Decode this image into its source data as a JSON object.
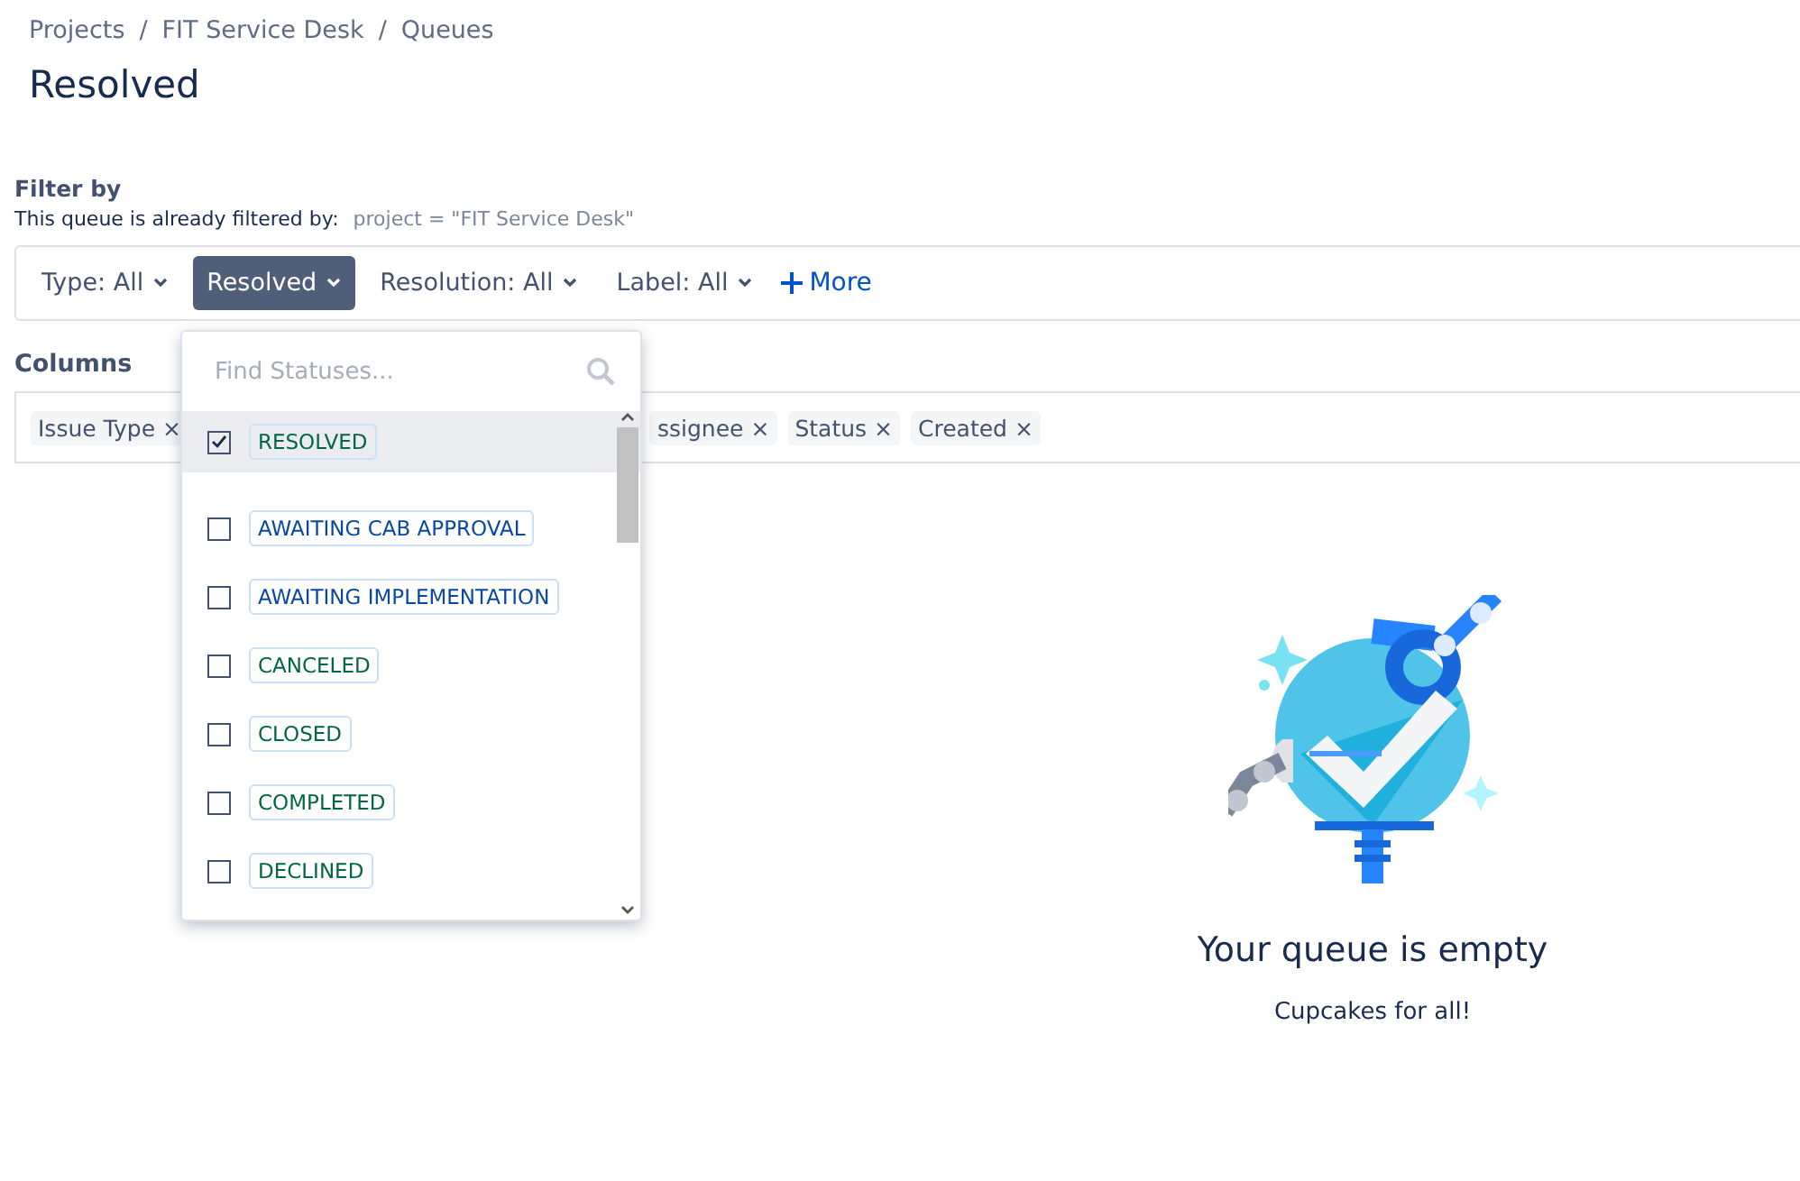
{
  "breadcrumbs": [
    {
      "label": "Projects"
    },
    {
      "separator": "/",
      "label": "FIT Service Desk"
    },
    {
      "separator": "/",
      "label": "Queues"
    }
  ],
  "title": "Resolved",
  "filter": {
    "heading": "Filter by",
    "note": "This queue is already filtered by:",
    "query": "project = \"FIT Service Desk\"",
    "buttons": [
      {
        "label": "Type: All",
        "selected": false
      },
      {
        "label": "Resolved",
        "selected": true
      },
      {
        "label": "Resolution: All",
        "selected": false
      },
      {
        "label": "Label: All",
        "selected": false
      }
    ],
    "more": "More"
  },
  "columns": {
    "heading": "Columns",
    "chips": [
      {
        "label": "Issue Type",
        "remove": "×"
      },
      {
        "label": "ssignee",
        "remove": "×"
      },
      {
        "label": "Status",
        "remove": "×"
      },
      {
        "label": "Created",
        "remove": "×"
      }
    ]
  },
  "dropdown": {
    "placeholder": "Find Statuses...",
    "items": [
      {
        "label": "RESOLVED",
        "checked": true,
        "selected": true,
        "color": "#006644"
      },
      {
        "label": "AWAITING CAB APPROVAL",
        "checked": false,
        "selected": false,
        "color": "#0747a6"
      },
      {
        "label": "AWAITING IMPLEMENTATION",
        "checked": false,
        "selected": false,
        "color": "#0747a6"
      },
      {
        "label": "CANCELED",
        "checked": false,
        "selected": false,
        "color": "#006644"
      },
      {
        "label": "CLOSED",
        "checked": false,
        "selected": false,
        "color": "#006644"
      },
      {
        "label": "COMPLETED",
        "checked": false,
        "selected": false,
        "color": "#006644"
      },
      {
        "label": "DECLINED",
        "checked": false,
        "selected": false,
        "color": "#006644"
      }
    ]
  },
  "empty": {
    "title": "Your queue is empty",
    "subtitle": "Cupcakes for all!"
  }
}
